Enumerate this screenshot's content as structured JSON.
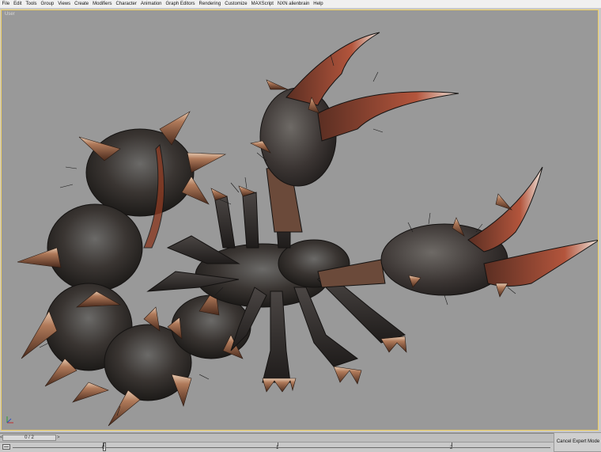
{
  "menu": {
    "items": [
      "File",
      "Edit",
      "Tools",
      "Group",
      "Views",
      "Create",
      "Modifiers",
      "Character",
      "Animation",
      "Graph Editors",
      "Rendering",
      "Customize",
      "MAXScript",
      "NXN alienbrain",
      "Help"
    ]
  },
  "viewport": {
    "label": "User",
    "gizmo_icon": "axis-tripod-icon"
  },
  "time_slider": {
    "frame_text": "0 / 2",
    "left_arrow": "<",
    "right_arrow": ">"
  },
  "track_bar": {
    "ticks": [
      "0",
      "1",
      "2"
    ]
  },
  "status": {
    "cancel_expert_mode": "Cancel Expert Mode"
  },
  "colors": {
    "viewport_bg": "#999999",
    "active_border": "#f0d060",
    "menubar_bg": "#f0f0f0"
  }
}
